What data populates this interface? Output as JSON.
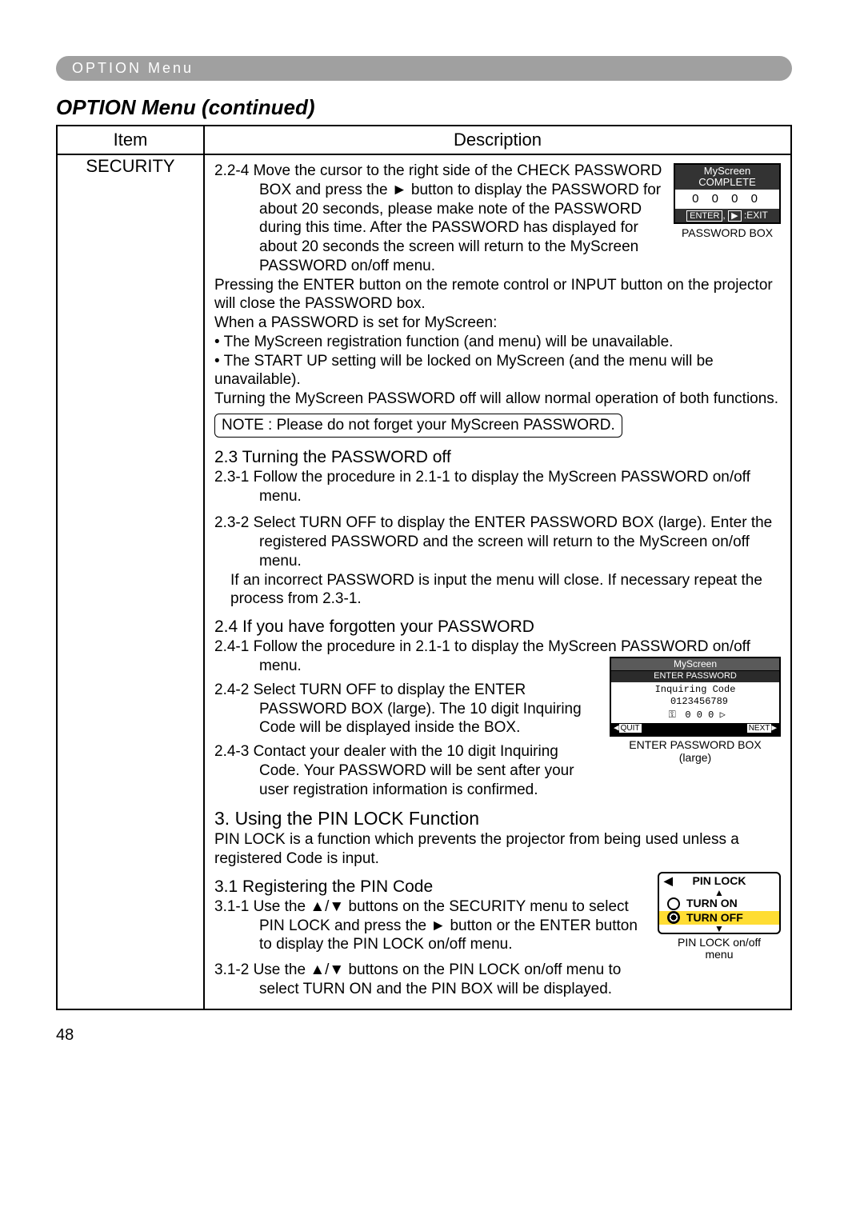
{
  "header_pill": "OPTION Menu",
  "page_title": "OPTION Menu (continued)",
  "table": {
    "head_item": "Item",
    "head_desc": "Description",
    "item_label": "SECURITY"
  },
  "p224": "2.2-4 Move the cursor to the right side of the CHECK PASSWORD BOX and press the ► button to display the PASSWORD for about 20 seconds, please make note of the PASSWORD during this time. After the PASSWORD has displayed for about 20 seconds the screen will return to the MyScreen PASSWORD on/off menu.",
  "p_press": "Pressing the ENTER button on the remote control or INPUT button on the projector will close the PASSWORD box.",
  "p_when": "When a PASSWORD is set for MyScreen:",
  "bul1": "• The MyScreen registration function (and menu) will be unavailable.",
  "bul2": "• The START UP setting will be locked on MyScreen (and the menu will be unavailable).",
  "p_turnoff": "Turning the MyScreen PASSWORD off will allow normal operation of both functions.",
  "note_text": "NOTE : Please do not forget your MyScreen PASSWORD.",
  "h23": "2.3 Turning the PASSWORD off",
  "p231": "2.3-1 Follow the procedure in 2.1-1 to display the MyScreen PASSWORD on/off menu.",
  "p232": "2.3-2 Select TURN OFF to display the ENTER PASSWORD BOX (large). Enter the registered PASSWORD and the screen will return to the MyScreen on/off menu.",
  "p232b": "If an incorrect PASSWORD is input the menu will close. If necessary repeat the process from 2.3-1.",
  "h24": "2.4 If you have forgotten your PASSWORD",
  "p241": "2.4-1 Follow the procedure in 2.1-1 to display the MyScreen PASSWORD on/off menu.",
  "p242": "2.4-2 Select TURN OFF to display the ENTER PASSWORD BOX (large). The 10 digit Inquiring Code will be displayed inside the BOX.",
  "p243": "2.4-3 Contact your dealer with the 10 digit Inquiring Code. Your PASSWORD will be sent after your user registration information is confirmed.",
  "h3": "3. Using the PIN LOCK Function",
  "p3": "PIN LOCK is a function which prevents the projector from being used unless a registered Code is input.",
  "h31": "3.1 Registering the PIN Code",
  "p311": "3.1-1 Use the ▲/▼ buttons on the SECURITY menu to select PIN LOCK and press the ► button or the ENTER button to display the PIN LOCK on/off menu.",
  "p312": "3.1-2 Use the ▲/▼ buttons on the PIN LOCK on/off menu to select TURN ON and the PIN BOX will be displayed.",
  "pwbox_small": {
    "line1": "MyScreen",
    "line2": "COMPLETE",
    "digits": "0  0  0  0",
    "ftr_enter": "ENTER",
    "ftr_play": "▶",
    "ftr_exit": ":EXIT",
    "caption": "PASSWORD BOX"
  },
  "pwbox_large": {
    "hdr1": "MyScreen",
    "hdr2": "ENTER PASSWORD",
    "inq_label": "Inquiring Code",
    "inq_code": "0123456789",
    "enter_digits": "0  0  0",
    "quit": "QUIT",
    "next": "NEXT",
    "caption1": "ENTER PASSWORD BOX",
    "caption2": "(large)"
  },
  "pin_menu": {
    "title": "PIN LOCK",
    "on": "TURN ON",
    "off": "TURN OFF",
    "caption1": "PIN LOCK on/off",
    "caption2": "menu"
  },
  "page_number": "48"
}
